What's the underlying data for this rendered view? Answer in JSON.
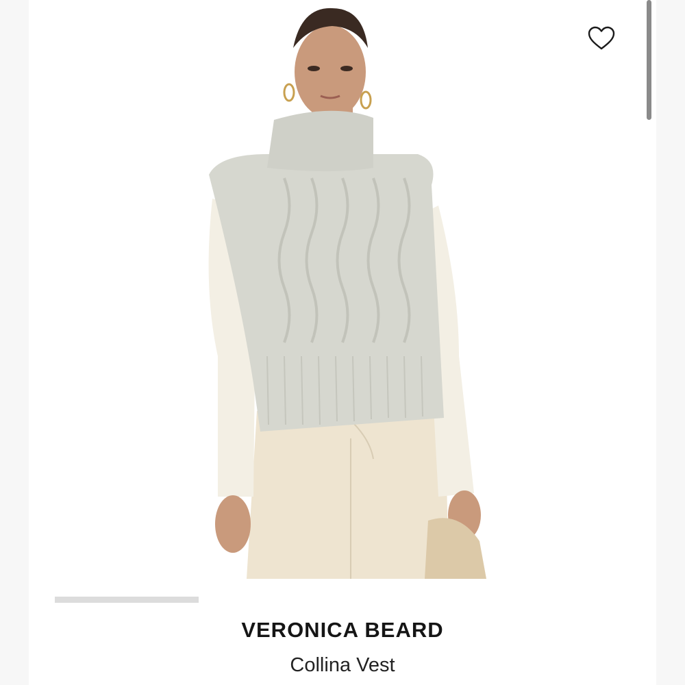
{
  "product": {
    "brand": "VERONICA BEARD",
    "name": "Collina Vest"
  },
  "favorite": {
    "icon": "heart-outline-icon"
  },
  "image_carousel": {
    "current_slide": 1
  },
  "colors": {
    "background": "#ffffff",
    "gutter": "#f7f7f7",
    "knit_vest": "#d6d7cf",
    "undershirt": "#f3efe4",
    "trousers": "#eee4d0",
    "skin": "#c99a7c",
    "text": "#151515"
  }
}
